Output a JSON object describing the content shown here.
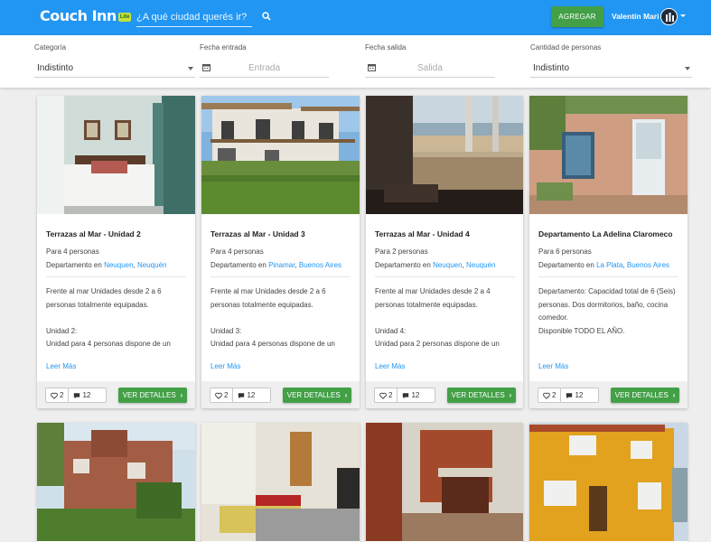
{
  "colors": {
    "primary": "#2196f3",
    "success": "#43a047",
    "badge": "#c6e23a",
    "link": "#2196f3"
  },
  "nav": {
    "logo": "Couch Inn",
    "logo_badge": "Lite",
    "search_placeholder": "¿A qué ciudad querés ir?",
    "search_icon": "search-icon",
    "add_button": "AGREGAR",
    "user_name": "Valentín Mari",
    "user_caret_icon": "caret-down-icon"
  },
  "filters": {
    "category": {
      "label": "Categoría",
      "value": "Indistinto"
    },
    "checkin": {
      "label": "Fecha entrada",
      "placeholder": "Entrada",
      "icon": "calendar-icon"
    },
    "checkout": {
      "label": "Fecha salida",
      "placeholder": "Salida",
      "icon": "calendar-icon"
    },
    "people": {
      "label": "Cantidad de personas",
      "value": "Indistinto"
    }
  },
  "listings": [
    {
      "title": "Terrazas al Mar - Unidad 2",
      "guests": "Para 4 personas",
      "type_prefix": "Departamento en",
      "city": "Neuquen",
      "province": "Neuquén",
      "description": "Frente al mar Unidades desde 2 a 6 personas totalmente equipadas.\n\nUnidad 2:\nUnidad para 4 personas dispone de un",
      "more": "Leer Más",
      "likes": "2",
      "comments": "12",
      "details": "VER DETALLES"
    },
    {
      "title": "Terrazas al Mar - Unidad 3",
      "guests": "Para 4 personas",
      "type_prefix": "Departamento en",
      "city": "Pinamar",
      "province": "Buenos Aires",
      "description": "Frente al mar Unidades desde 2 a 6 personas totalmente equipadas.\n\nUnidad 3:\nUnidad para 4 personas dispone de un",
      "more": "Leer Más",
      "likes": "2",
      "comments": "12",
      "details": "VER DETALLES"
    },
    {
      "title": "Terrazas al Mar - Unidad 4",
      "guests": "Para 2 personas",
      "type_prefix": "Departamento en",
      "city": "Neuquen",
      "province": "Neuquén",
      "description": "Frente al mar Unidades desde 2 a 4 personas totalmente equipadas.\n\nUnidad 4:\nUnidad para 2 personas dispone de un",
      "more": "Leer Más",
      "likes": "2",
      "comments": "12",
      "details": "VER DETALLES"
    },
    {
      "title": "Departamento La Adelina Claromeco",
      "guests": "Para 6 personas",
      "type_prefix": "Departamento en",
      "city": "La Plata",
      "province": "Buenos Aires",
      "description": "Departamento: Capacidad total de 6 (Seis) personas. Dos dormitorios, baño, cocina comedor.\nDisponible TODO EL AÑO.",
      "more": "Leer Más",
      "likes": "2",
      "comments": "12",
      "details": "VER DETALLES"
    }
  ],
  "icons": {
    "like": "heart-icon",
    "comment": "comment-icon",
    "details_chevron": "chevron-right-icon"
  }
}
